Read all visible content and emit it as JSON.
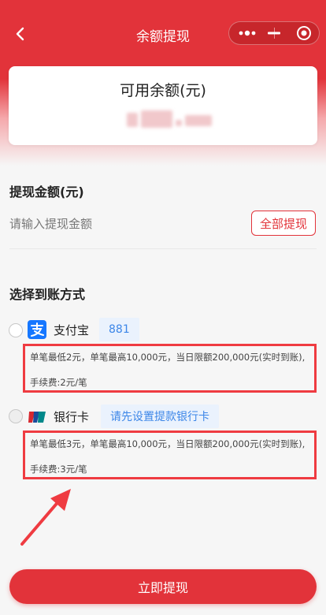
{
  "nav": {
    "title": "余额提现"
  },
  "balance": {
    "label": "可用余额(元)"
  },
  "withdraw": {
    "section_title": "提现金额(元)",
    "placeholder": "请输入提现金额",
    "all_button": "全部提现"
  },
  "methods": {
    "section_title": "选择到账方式",
    "items": [
      {
        "label": "支付宝",
        "tag": "881",
        "info_line1": "单笔最低2元，单笔最高10,000元，当日限额200,000元(实时到账),",
        "info_line2": "手续费:2元/笔"
      },
      {
        "label": "银行卡",
        "tag": "请先设置提款银行卡",
        "info_line1": "单笔最低3元，单笔最高10,000元，当日限额200,000元(实时到账),",
        "info_line2": "手续费:3元/笔"
      }
    ]
  },
  "submit": {
    "label": "立即提现"
  },
  "colors": {
    "primary": "#e2333a",
    "highlight": "#ef3b41",
    "tag_text": "#3c86e8",
    "tag_bg": "#eaf2fd"
  },
  "icons": [
    "back-arrow-icon",
    "more-dots-icon",
    "minimize-icon",
    "close-target-icon",
    "alipay-icon",
    "unionpay-icon",
    "pointer-arrow-icon"
  ]
}
